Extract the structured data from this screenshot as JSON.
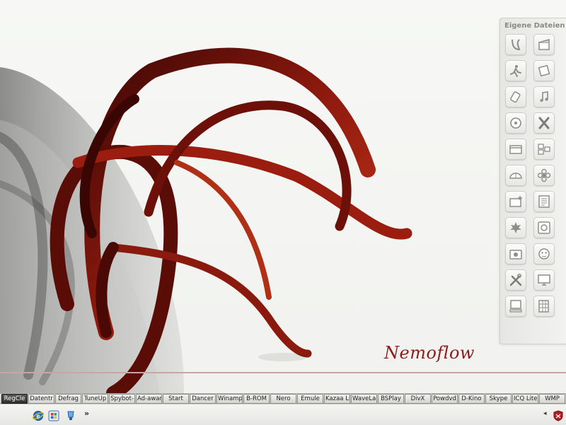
{
  "side_panel": {
    "title": "Eigene Dateien",
    "icons": [
      "leaf-curl-icon",
      "slate-icon",
      "runner-icon",
      "frame-icon",
      "tag-icon",
      "music-note-icon",
      "cd-icon",
      "x-mark-icon",
      "window-icon",
      "blocks-icon",
      "dome-icon",
      "flower-icon",
      "card-plus-icon",
      "document-lines-icon",
      "maple-leaf-icon",
      "disc-drive-icon",
      "camera-icon",
      "face-icon",
      "tools-icon",
      "monitor-icon",
      "computer-icon",
      "grid-doc-icon"
    ]
  },
  "wallpaper": {
    "brand_text": "Nemoflow",
    "accent_color": "#7a150d"
  },
  "quick_launch": {
    "items": [
      "RegCle",
      "Datentr",
      "Defrag",
      "TuneUp",
      "Spybot-",
      "Ad-awar",
      "Start",
      "Dancer",
      "Winamp",
      "B-ROM",
      "Nero",
      "Emule",
      "Kazaa Li",
      "WaveLa",
      "BSPlay",
      "DivX",
      "Powdvd",
      "D-Kino",
      "Skype",
      "ICQ Lite",
      "WMP"
    ],
    "active_index": 0
  },
  "taskbar": {
    "icons": [
      "internet-explorer-icon",
      "windows-icon",
      "media-icon"
    ],
    "more_label": "»",
    "tray_arrow": "◂",
    "tray_icons": [
      "shield-icon"
    ]
  }
}
